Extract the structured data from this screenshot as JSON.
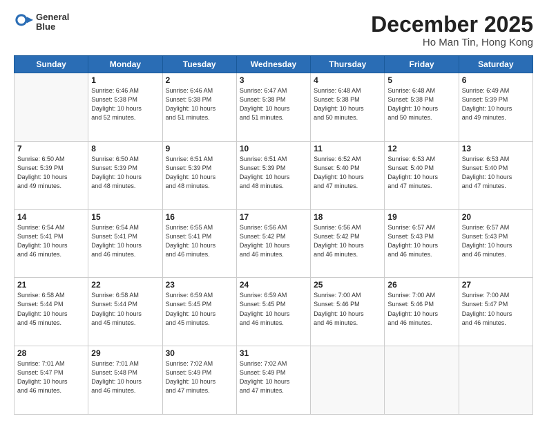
{
  "header": {
    "logo_line1": "General",
    "logo_line2": "Blue",
    "title": "December 2025",
    "subtitle": "Ho Man Tin, Hong Kong"
  },
  "weekdays": [
    "Sunday",
    "Monday",
    "Tuesday",
    "Wednesday",
    "Thursday",
    "Friday",
    "Saturday"
  ],
  "weeks": [
    [
      {
        "day": "",
        "info": ""
      },
      {
        "day": "1",
        "info": "Sunrise: 6:46 AM\nSunset: 5:38 PM\nDaylight: 10 hours\nand 52 minutes."
      },
      {
        "day": "2",
        "info": "Sunrise: 6:46 AM\nSunset: 5:38 PM\nDaylight: 10 hours\nand 51 minutes."
      },
      {
        "day": "3",
        "info": "Sunrise: 6:47 AM\nSunset: 5:38 PM\nDaylight: 10 hours\nand 51 minutes."
      },
      {
        "day": "4",
        "info": "Sunrise: 6:48 AM\nSunset: 5:38 PM\nDaylight: 10 hours\nand 50 minutes."
      },
      {
        "day": "5",
        "info": "Sunrise: 6:48 AM\nSunset: 5:38 PM\nDaylight: 10 hours\nand 50 minutes."
      },
      {
        "day": "6",
        "info": "Sunrise: 6:49 AM\nSunset: 5:39 PM\nDaylight: 10 hours\nand 49 minutes."
      }
    ],
    [
      {
        "day": "7",
        "info": "Sunrise: 6:50 AM\nSunset: 5:39 PM\nDaylight: 10 hours\nand 49 minutes."
      },
      {
        "day": "8",
        "info": "Sunrise: 6:50 AM\nSunset: 5:39 PM\nDaylight: 10 hours\nand 48 minutes."
      },
      {
        "day": "9",
        "info": "Sunrise: 6:51 AM\nSunset: 5:39 PM\nDaylight: 10 hours\nand 48 minutes."
      },
      {
        "day": "10",
        "info": "Sunrise: 6:51 AM\nSunset: 5:39 PM\nDaylight: 10 hours\nand 48 minutes."
      },
      {
        "day": "11",
        "info": "Sunrise: 6:52 AM\nSunset: 5:40 PM\nDaylight: 10 hours\nand 47 minutes."
      },
      {
        "day": "12",
        "info": "Sunrise: 6:53 AM\nSunset: 5:40 PM\nDaylight: 10 hours\nand 47 minutes."
      },
      {
        "day": "13",
        "info": "Sunrise: 6:53 AM\nSunset: 5:40 PM\nDaylight: 10 hours\nand 47 minutes."
      }
    ],
    [
      {
        "day": "14",
        "info": "Sunrise: 6:54 AM\nSunset: 5:41 PM\nDaylight: 10 hours\nand 46 minutes."
      },
      {
        "day": "15",
        "info": "Sunrise: 6:54 AM\nSunset: 5:41 PM\nDaylight: 10 hours\nand 46 minutes."
      },
      {
        "day": "16",
        "info": "Sunrise: 6:55 AM\nSunset: 5:41 PM\nDaylight: 10 hours\nand 46 minutes."
      },
      {
        "day": "17",
        "info": "Sunrise: 6:56 AM\nSunset: 5:42 PM\nDaylight: 10 hours\nand 46 minutes."
      },
      {
        "day": "18",
        "info": "Sunrise: 6:56 AM\nSunset: 5:42 PM\nDaylight: 10 hours\nand 46 minutes."
      },
      {
        "day": "19",
        "info": "Sunrise: 6:57 AM\nSunset: 5:43 PM\nDaylight: 10 hours\nand 46 minutes."
      },
      {
        "day": "20",
        "info": "Sunrise: 6:57 AM\nSunset: 5:43 PM\nDaylight: 10 hours\nand 46 minutes."
      }
    ],
    [
      {
        "day": "21",
        "info": "Sunrise: 6:58 AM\nSunset: 5:44 PM\nDaylight: 10 hours\nand 45 minutes."
      },
      {
        "day": "22",
        "info": "Sunrise: 6:58 AM\nSunset: 5:44 PM\nDaylight: 10 hours\nand 45 minutes."
      },
      {
        "day": "23",
        "info": "Sunrise: 6:59 AM\nSunset: 5:45 PM\nDaylight: 10 hours\nand 45 minutes."
      },
      {
        "day": "24",
        "info": "Sunrise: 6:59 AM\nSunset: 5:45 PM\nDaylight: 10 hours\nand 46 minutes."
      },
      {
        "day": "25",
        "info": "Sunrise: 7:00 AM\nSunset: 5:46 PM\nDaylight: 10 hours\nand 46 minutes."
      },
      {
        "day": "26",
        "info": "Sunrise: 7:00 AM\nSunset: 5:46 PM\nDaylight: 10 hours\nand 46 minutes."
      },
      {
        "day": "27",
        "info": "Sunrise: 7:00 AM\nSunset: 5:47 PM\nDaylight: 10 hours\nand 46 minutes."
      }
    ],
    [
      {
        "day": "28",
        "info": "Sunrise: 7:01 AM\nSunset: 5:47 PM\nDaylight: 10 hours\nand 46 minutes."
      },
      {
        "day": "29",
        "info": "Sunrise: 7:01 AM\nSunset: 5:48 PM\nDaylight: 10 hours\nand 46 minutes."
      },
      {
        "day": "30",
        "info": "Sunrise: 7:02 AM\nSunset: 5:49 PM\nDaylight: 10 hours\nand 47 minutes."
      },
      {
        "day": "31",
        "info": "Sunrise: 7:02 AM\nSunset: 5:49 PM\nDaylight: 10 hours\nand 47 minutes."
      },
      {
        "day": "",
        "info": ""
      },
      {
        "day": "",
        "info": ""
      },
      {
        "day": "",
        "info": ""
      }
    ]
  ]
}
